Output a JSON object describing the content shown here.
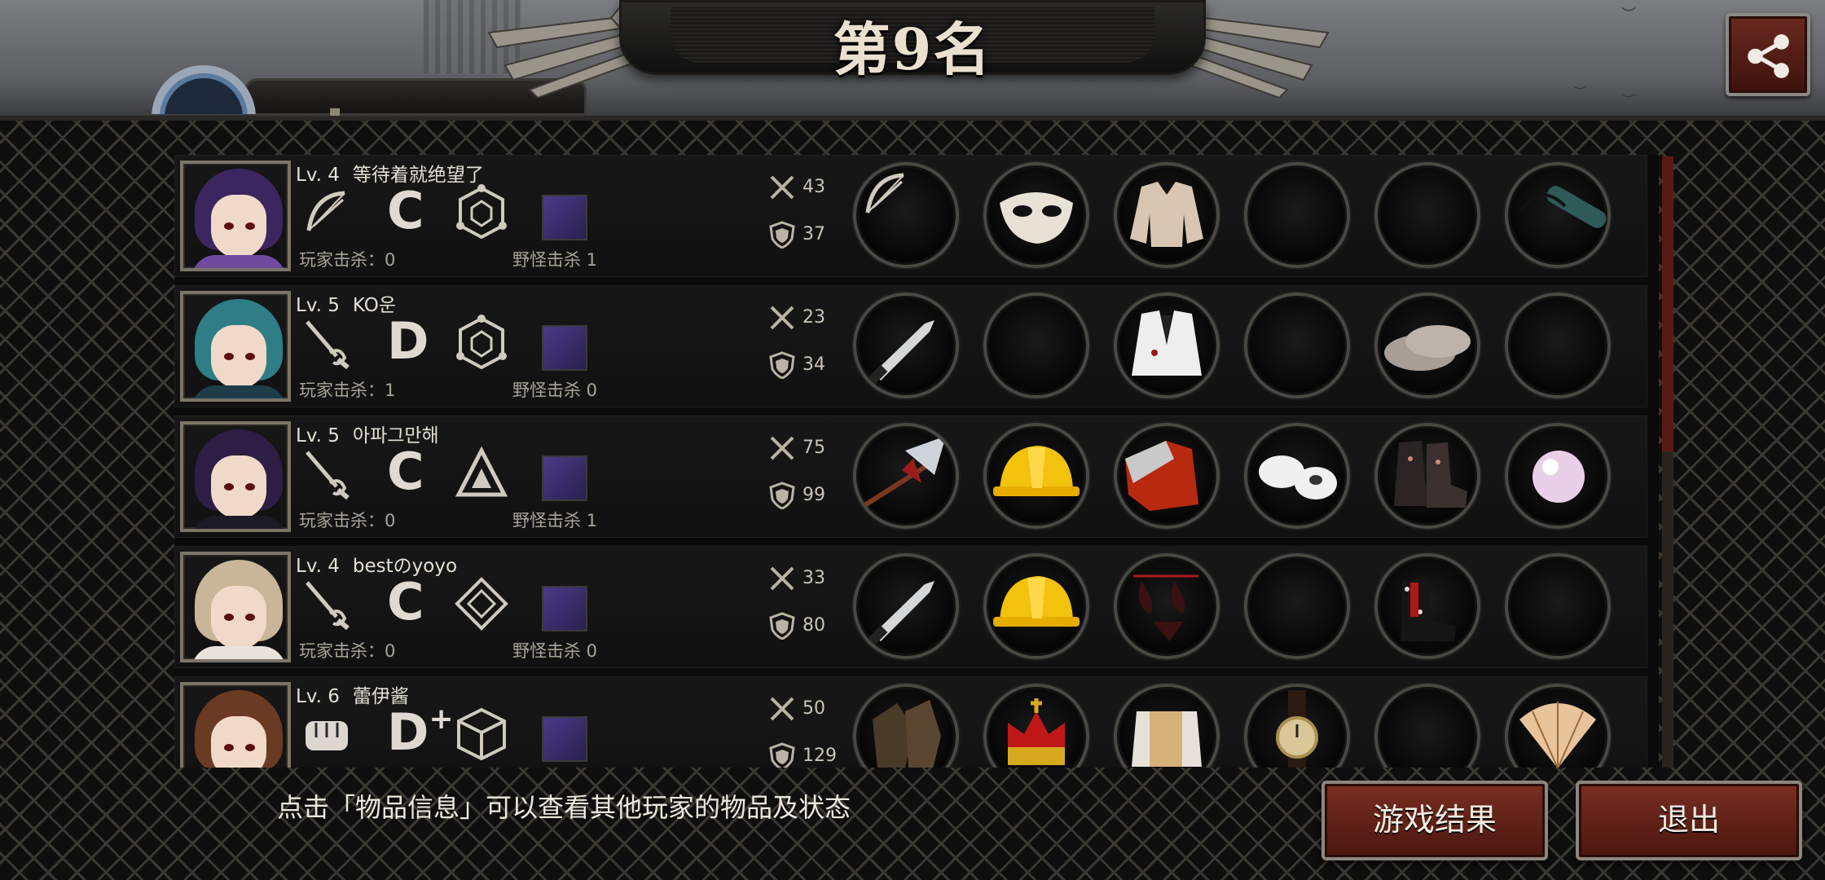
{
  "header": {
    "rank_title": "第9名",
    "tab_label": "▪"
  },
  "players": [
    {
      "level": "Lv. 4",
      "name": "等待着就绝望了",
      "weapon_icon": "bow-icon",
      "grade": "C",
      "grade_plus": "",
      "emblem_icon": "hexagon-emblem-icon",
      "player_kills": "玩家击杀：0",
      "monster_kills": "野怪击杀 1",
      "attack": "43",
      "defense": "37",
      "items": [
        "bow-icon",
        "mask-icon",
        "jacket-icon",
        "",
        "",
        "tube-bag-icon"
      ],
      "avatar_colors": {
        "hair": "#3b2660",
        "body": "#6f4a9e"
      }
    },
    {
      "level": "Lv. 5",
      "name": "KO운",
      "weapon_icon": "rapier-icon",
      "grade": "D",
      "grade_plus": "",
      "emblem_icon": "hexagon-emblem-icon",
      "player_kills": "玩家击杀：1",
      "monster_kills": "野怪击杀 0",
      "attack": "23",
      "defense": "34",
      "items": [
        "knife-icon",
        "",
        "suit-icon",
        "",
        "slippers-icon",
        ""
      ],
      "avatar_colors": {
        "hair": "#2f7d86",
        "body": "#1e3c4a"
      }
    },
    {
      "level": "Lv. 5",
      "name": "아파그만해",
      "weapon_icon": "rapier-icon",
      "grade": "C",
      "grade_plus": "",
      "emblem_icon": "triangle-emblem-icon",
      "player_kills": "玩家击杀：0",
      "monster_kills": "野怪击杀 1",
      "attack": "75",
      "defense": "99",
      "items": [
        "halberd-icon",
        "hard-hat-icon",
        "red-cloth-icon",
        "bandage-icon",
        "boots-icon",
        "pearl-icon"
      ],
      "avatar_colors": {
        "hair": "#2c1e44",
        "body": "#1c1a24"
      }
    },
    {
      "level": "Lv. 4",
      "name": "bestのyoyo",
      "weapon_icon": "rapier-icon",
      "grade": "C",
      "grade_plus": "",
      "emblem_icon": "diamond-emblem-icon",
      "player_kills": "玩家击杀：0",
      "monster_kills": "野怪击杀 0",
      "attack": "33",
      "defense": "80",
      "items": [
        "knife-icon",
        "hard-hat-icon",
        "bikini-icon",
        "",
        "spiked-boots-icon",
        ""
      ],
      "avatar_colors": {
        "hair": "#c9b597",
        "body": "#e8e4dc"
      }
    },
    {
      "level": "Lv. 6",
      "name": "蕾伊酱",
      "weapon_icon": "fist-icon",
      "grade": "D",
      "grade_plus": "+",
      "emblem_icon": "cube-emblem-icon",
      "player_kills": "",
      "monster_kills": "",
      "attack": "50",
      "defense": "129",
      "items": [
        "gloves-icon",
        "crown-icon",
        "armor-icon",
        "watch-icon",
        "",
        "fan-icon"
      ],
      "avatar_colors": {
        "hair": "#6b3a22",
        "body": "#6a3a9a"
      }
    }
  ],
  "footer": {
    "hint": "点击「物品信息」可以查看其他玩家的物品及状态",
    "result_button": "游戏结果",
    "exit_button": "退出"
  }
}
